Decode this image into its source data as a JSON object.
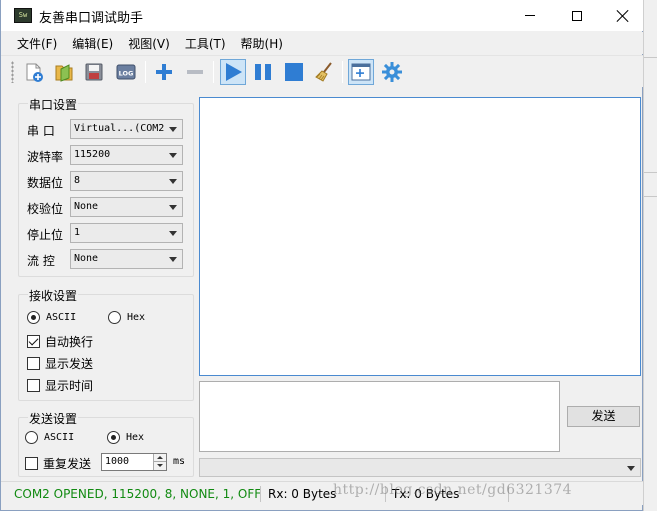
{
  "window": {
    "title": "友善串口调试助手",
    "app_icon_text": "Sw"
  },
  "menu": [
    "文件(F)",
    "编辑(E)",
    "视图(V)",
    "工具(T)",
    "帮助(H)"
  ],
  "toolbar": {
    "icons": [
      "new-file-icon",
      "open-folder-icon",
      "save-disk-icon",
      "log-icon",
      "add-icon",
      "remove-icon",
      "play-icon",
      "pause-icon",
      "stop-icon",
      "broom-clear-icon",
      "window-add-icon",
      "settings-gear-icon"
    ],
    "log_text": "LOG",
    "active": [
      "play-icon",
      "window-add-icon"
    ],
    "accent": "#2f7dd3"
  },
  "serial_settings": {
    "title": "串口设置",
    "rows": [
      {
        "label": "串  口",
        "value": "Virtual...(COM2"
      },
      {
        "label": "波特率",
        "value": "115200"
      },
      {
        "label": "数据位",
        "value": "8"
      },
      {
        "label": "校验位",
        "value": "None"
      },
      {
        "label": "停止位",
        "value": "1"
      },
      {
        "label": "流  控",
        "value": "None"
      }
    ]
  },
  "receive_settings": {
    "title": "接收设置",
    "ascii_label": "ASCII",
    "hex_label": "Hex",
    "ascii_selected": true,
    "auto_newline_label": "自动换行",
    "auto_newline": true,
    "show_send_label": "显示发送",
    "show_send": false,
    "show_time_label": "显示时间",
    "show_time": false
  },
  "send_settings": {
    "title": "发送设置",
    "ascii_label": "ASCII",
    "hex_label": "Hex",
    "hex_selected": true,
    "repeat_label": "重复发送",
    "repeat": false,
    "interval_value": "1000",
    "interval_unit": "ms"
  },
  "send_button": "发送",
  "status": {
    "port_info": "COM2 OPENED, 115200, 8, NONE, 1, OFF",
    "port_color": "#118a11",
    "rx": "Rx: 0 Bytes",
    "tx": "Tx: 0 Bytes"
  },
  "watermark": "http://blog.csdn.net/gd6321374"
}
